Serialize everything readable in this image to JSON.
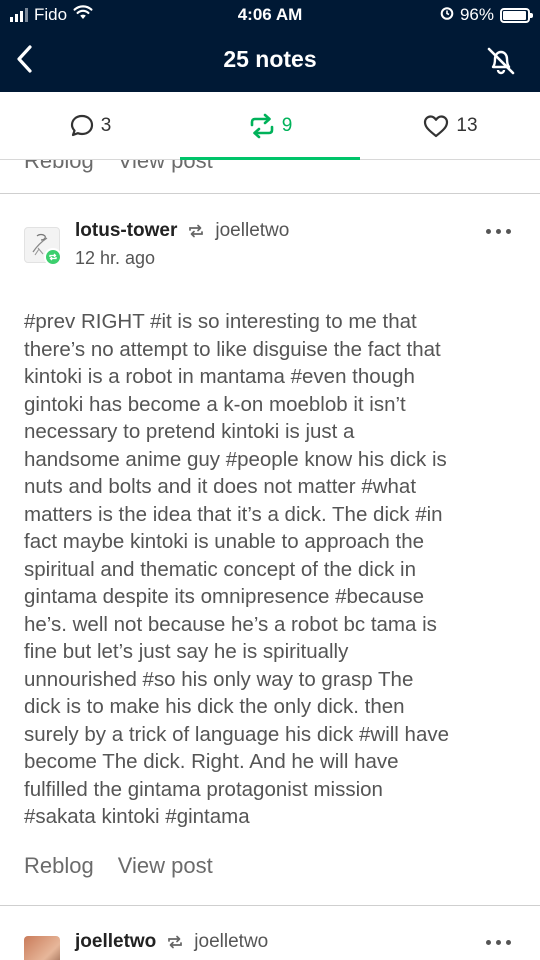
{
  "status_bar": {
    "carrier": "Fido",
    "time": "4:06 AM",
    "battery_percent": "96%",
    "battery_level": 0.96
  },
  "header": {
    "title": "25 notes",
    "back_icon": "chevron-left-icon",
    "mute_icon": "bell-off-icon"
  },
  "tabs": {
    "replies_count": "3",
    "reblogs_count": "9",
    "likes_count": "13",
    "active": "reblogs",
    "active_color": "#00b25a"
  },
  "prev_footer": {
    "reblog_label": "Reblog",
    "view_label": "View post"
  },
  "post": {
    "username": "lotus-tower",
    "reblogged_from": "joelletwo",
    "time": "12 hr. ago",
    "body_lines": [
      "#prev RIGHT  #it is so interesting to me that",
      "there’s no attempt to like disguise the fact that",
      "kintoki is a robot in mantama  #even though",
      "gintoki has become a k-on moeblob it isn’t",
      "necessary to pretend kintoki is just a",
      "handsome anime guy  #people know his dick is",
      "nuts and bolts and it does not matter  #what",
      "matters is the idea that it’s a dick. The dick  #in",
      "fact maybe kintoki is unable to approach the",
      "spiritual and thematic concept of the dick in",
      "gintama despite its omnipresence  #because",
      "he’s. well not because he’s a robot bc tama is",
      "fine but let’s just say he is spiritually",
      "unnourished  #so his only way to grasp The",
      "dick is to make his dick the only dick. then",
      "surely by a trick of language his dick  #will have",
      "become The dick. Right. And he will have",
      "fulfilled the gintama protagonist mission",
      "#sakata kintoki  #gintama"
    ],
    "reblog_label": "Reblog",
    "view_label": "View post"
  },
  "next_post": {
    "username": "joelletwo",
    "reblogged_from": "joelletwo"
  }
}
